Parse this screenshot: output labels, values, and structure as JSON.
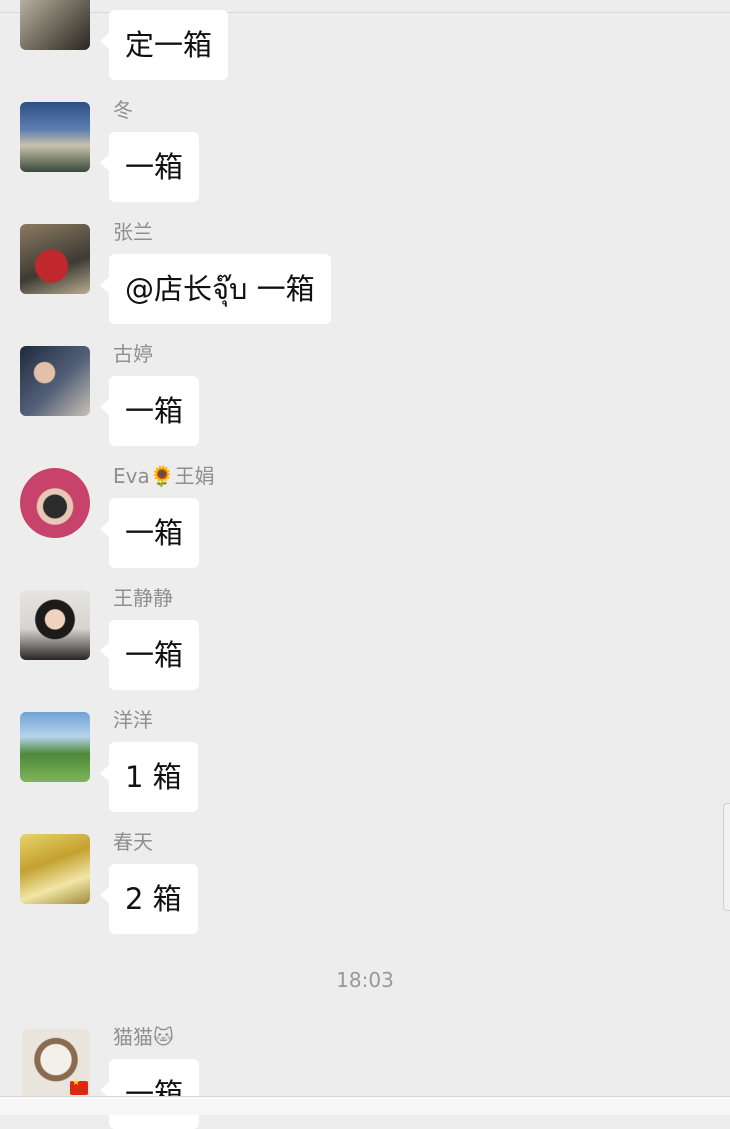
{
  "messages": [
    {
      "sender": "",
      "text": "定一箱",
      "avatar_icon": "woman-photo-icon"
    },
    {
      "sender": "冬",
      "text": "一箱",
      "avatar_icon": "castle-photo-icon"
    },
    {
      "sender": "张兰",
      "text": "@店长จุ๊บ 一箱",
      "avatar_icon": "drink-photo-icon"
    },
    {
      "sender": "古婷",
      "text": "一箱",
      "avatar_icon": "woman-photo-icon"
    },
    {
      "sender": "Eva🌻王娟",
      "text": "一箱",
      "avatar_icon": "masked-woman-photo-icon"
    },
    {
      "sender": "王静静",
      "text": "一箱",
      "avatar_icon": "woman-photo-icon"
    },
    {
      "sender": "洋洋",
      "text": "1 箱",
      "avatar_icon": "tree-landscape-icon"
    },
    {
      "sender": "春天",
      "text": "2 箱",
      "avatar_icon": "autumn-landscape-icon"
    },
    {
      "sender": "猫猫🐱",
      "text": "一箱",
      "avatar_icon": "cat-photo-icon"
    }
  ],
  "timestamp": "18:03",
  "colors": {
    "background": "#ededed",
    "bubble": "#ffffff",
    "name_text": "#8f8f8f",
    "timestamp_text": "#999999"
  }
}
